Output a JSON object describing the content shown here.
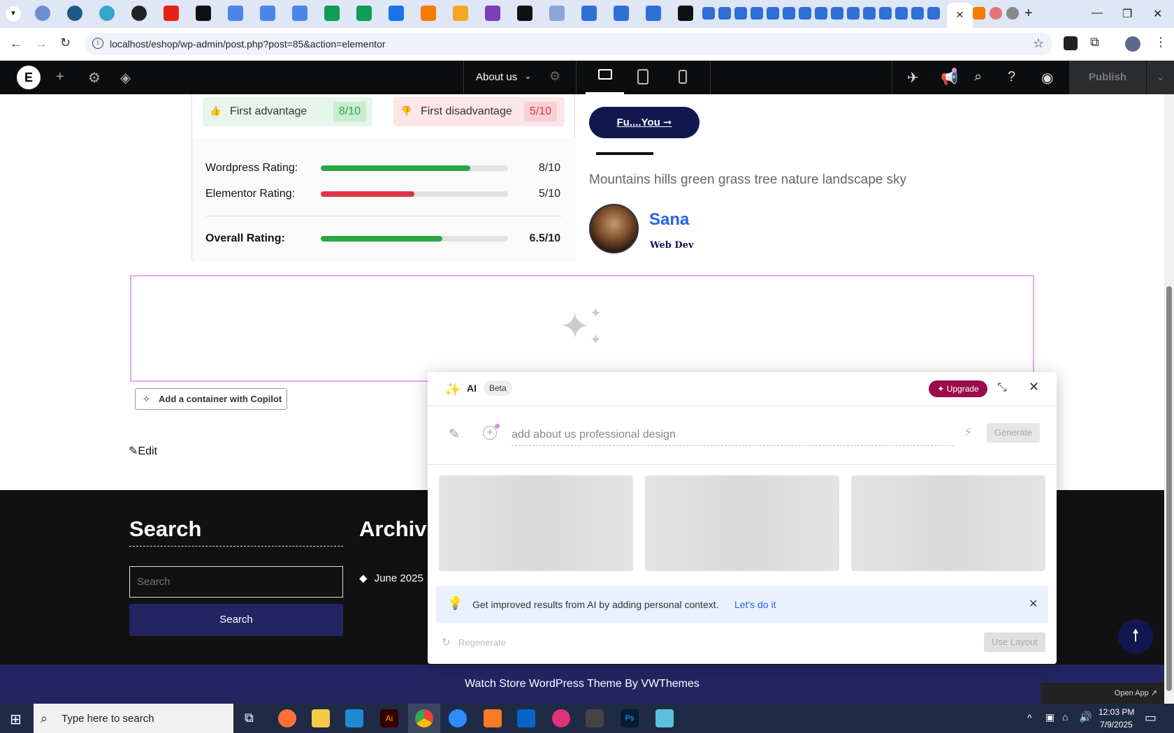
{
  "browser": {
    "url": "localhost/eshop/wp-admin/post.php?post=85&action=elementor",
    "active_tab_close": "✕",
    "new_tab": "+"
  },
  "elementor_bar": {
    "page_name": "About us",
    "publish_label": "Publish"
  },
  "review": {
    "advantage": {
      "label": "First advantage",
      "score": "8/10"
    },
    "disadvantage": {
      "label": "First disadvantage",
      "score": "5/10"
    },
    "ratings": [
      {
        "label": "Wordpress Rating:",
        "value": "8/10",
        "fraction": 0.8,
        "color": "#28a745"
      },
      {
        "label": "Elementor Rating:",
        "value": "5/10",
        "fraction": 0.5,
        "color": "#dc3545"
      }
    ],
    "overall": {
      "label": "Overall Rating:",
      "value": "6.5/10",
      "fraction": 0.65,
      "color": "#28a745"
    }
  },
  "right_column": {
    "button_label": "Fu....You ➞",
    "caption": "Mountains hills green grass tree nature landscape sky",
    "author_name": "Sana",
    "author_role": "Web Dev"
  },
  "copilot": {
    "add_container_label": "Add a container with Copilot",
    "edit_label": "Edit"
  },
  "ai_panel": {
    "title": "AI",
    "beta": "Beta",
    "upgrade": "Upgrade",
    "prompt_placeholder": "add about us professional design",
    "generate": "Generate",
    "tip_text": "Get improved results from AI by adding personal context.",
    "tip_link": "Let's do it",
    "regenerate": "Regenerate",
    "use_layout": "Use Layout"
  },
  "footer": {
    "search_heading": "Search",
    "search_placeholder": "Search",
    "search_button": "Search",
    "archive_heading": "Archiv",
    "archive_item": "June 2025",
    "credit": "Watch Store WordPress Theme By VWThemes",
    "open_app": "Open App ↗"
  },
  "taskbar": {
    "search_placeholder": "Type here to search",
    "time": "12:03 PM",
    "date": "7/9/2025"
  },
  "colors": {
    "accent_pink": "#9b0c4b",
    "navy": "#10184f",
    "link_blue": "#2563eb"
  }
}
